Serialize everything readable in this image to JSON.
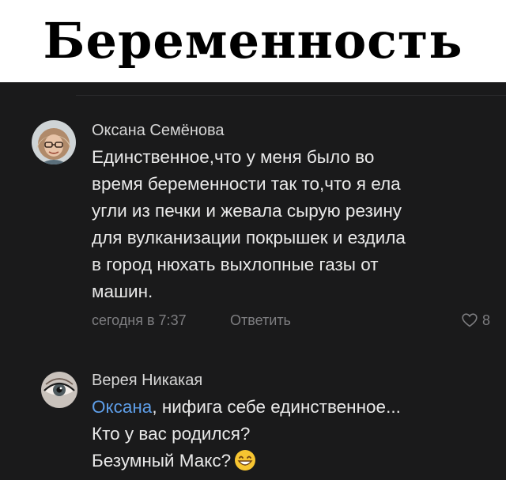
{
  "header": {
    "title": "Беременность"
  },
  "comments": [
    {
      "author": "Оксана Семёнова",
      "text": "Единственное,что у меня было во\nвремя беременности так то,что я ела\nугли из печки и жевала сырую резину\nдля вулканизации покрышек и ездила\nв город нюхать выхлопные газы от\nмашин.",
      "time": "сегодня в 7:37",
      "reply_label": "Ответить",
      "likes": "8",
      "avatar_icon": "user-photo-avatar"
    },
    {
      "author": "Верея Никакая",
      "mention": "Оксана",
      "text_after_mention": ", нифига себе единственное...\nКто у вас родился?\nБезумный Макс?",
      "emoji_icon": "grinning-emoji-icon",
      "avatar_icon": "eye-photo-avatar"
    }
  ],
  "colors": {
    "background": "#1a1a1b",
    "header_bg": "#ffffff",
    "text": "#e9e9e9",
    "muted": "#7d7d80",
    "link": "#5e9ee8"
  }
}
